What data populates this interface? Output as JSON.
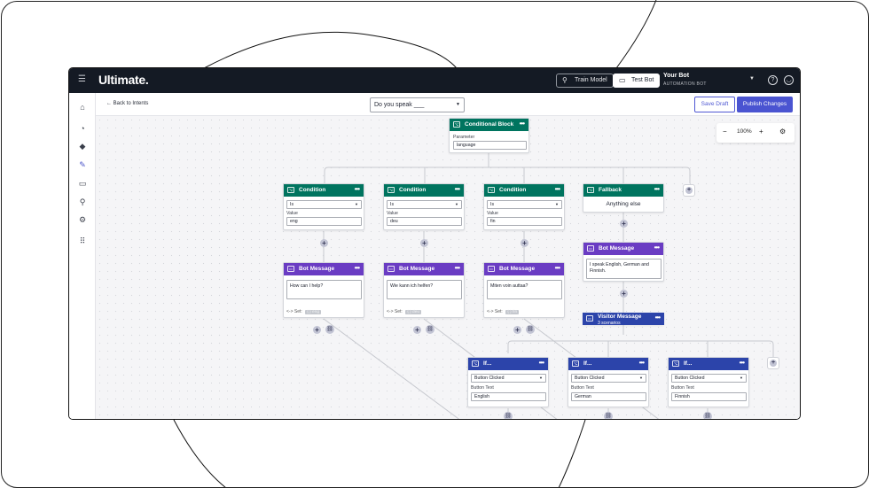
{
  "topbar": {
    "brand": "Ultimate.",
    "train_label": "Train Model",
    "test_label": "Test Bot",
    "bot_name": "Your Bot",
    "bot_subtitle": "AUTOMATION BOT",
    "help_icon": "help-circle-icon",
    "account_icon": "user-circle-icon"
  },
  "sidebar": {
    "items": [
      "home-icon",
      "intents-icon",
      "learn-icon",
      "edit-icon",
      "messages-icon",
      "integrations-icon",
      "settings-icon",
      "apps-icon"
    ],
    "active": "edit-icon"
  },
  "subbar": {
    "back_label": "Back to Intents",
    "intent_value": "Do you speak ___",
    "save_draft": "Save Draft",
    "publish": "Publish Changes"
  },
  "zoom": {
    "minus": "−",
    "level": "100%",
    "plus": "+"
  },
  "flow": {
    "conditional_block": {
      "title": "Conditional Block",
      "param_label": "Parameter",
      "param_value": "language"
    },
    "conditions": [
      {
        "title": "Condition",
        "operator": "Is",
        "value_label": "Value",
        "value": "eng"
      },
      {
        "title": "Condition",
        "operator": "Is",
        "value_label": "Value",
        "value": "deu"
      },
      {
        "title": "Condition",
        "operator": "Is",
        "value_label": "Value",
        "value": "fin"
      }
    ],
    "fallback": {
      "title": "Fallback",
      "text": "Anything else"
    },
    "bot_messages": [
      {
        "title": "Bot Message",
        "text": "How can I help?",
        "set_label": "<-> Set:",
        "set_value": "{ } eng"
      },
      {
        "title": "Bot Message",
        "text": "Wie kann ich helfen?",
        "set_label": "<-> Set:",
        "set_value": "{ } deu"
      },
      {
        "title": "Bot Message",
        "text": "Miten voin auttaa?",
        "set_label": "<-> Set:",
        "set_value": "{ } fin"
      }
    ],
    "fallback_message": {
      "title": "Bot Message",
      "text": "I speak English, German and Finnish."
    },
    "visitor_message": {
      "title": "Visitor Message",
      "subtitle": "3 scenarios"
    },
    "if_nodes": [
      {
        "title": "If...",
        "select": "Button Clicked",
        "label": "Button Text",
        "value": "English"
      },
      {
        "title": "If...",
        "select": "Button Clicked",
        "label": "Button Text",
        "value": "German"
      },
      {
        "title": "If...",
        "select": "Button Clicked",
        "label": "Button Text",
        "value": "Finnish"
      }
    ]
  }
}
